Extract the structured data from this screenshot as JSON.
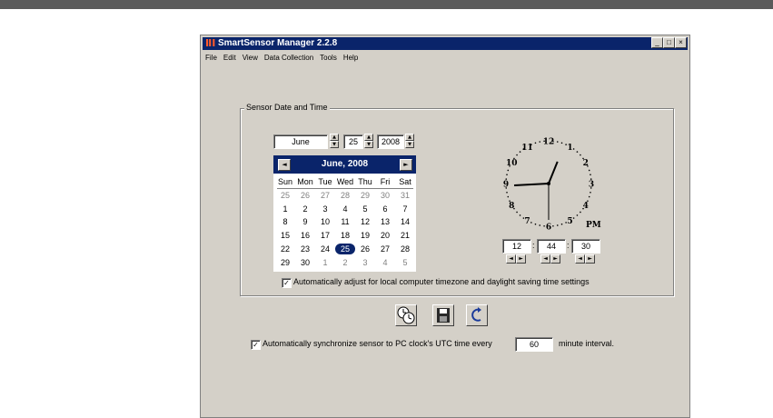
{
  "window": {
    "title": "SmartSensor Manager 2.2.8",
    "controls": {
      "minimize": "_",
      "maximize": "□",
      "close": "×"
    }
  },
  "menu": [
    "File",
    "Edit",
    "View",
    "Data Collection",
    "Tools",
    "Help"
  ],
  "group": {
    "label": "Sensor Date and Time"
  },
  "date": {
    "month": "June",
    "day": "25",
    "year": "2008"
  },
  "calendar": {
    "title": "June, 2008",
    "prev_icon": "◄",
    "next_icon": "►",
    "weekdays": [
      "Sun",
      "Mon",
      "Tue",
      "Wed",
      "Thu",
      "Fri",
      "Sat"
    ],
    "weeks": [
      [
        "25",
        "26",
        "27",
        "28",
        "29",
        "30",
        "31"
      ],
      [
        "1",
        "2",
        "3",
        "4",
        "5",
        "6",
        "7"
      ],
      [
        "8",
        "9",
        "10",
        "11",
        "12",
        "13",
        "14"
      ],
      [
        "15",
        "16",
        "17",
        "18",
        "19",
        "20",
        "21"
      ],
      [
        "22",
        "23",
        "24",
        "25",
        "26",
        "27",
        "28"
      ],
      [
        "29",
        "30",
        "1",
        "2",
        "3",
        "4",
        "5"
      ]
    ],
    "selected": "25"
  },
  "clock": {
    "numerals": [
      "12",
      "1",
      "2",
      "3",
      "4",
      "5",
      "6",
      "7",
      "8",
      "9",
      "10",
      "11"
    ],
    "ampm": "PM",
    "hour": "12",
    "minute": "44",
    "second": "30",
    "sep": ":"
  },
  "auto_adjust": {
    "checked": true,
    "label": "Automatically adjust for local computer timezone and daylight saving time settings"
  },
  "toolbar": {
    "icons": [
      "sync-clock-icon",
      "save-icon",
      "refresh-icon"
    ]
  },
  "auto_sync": {
    "checked": true,
    "label_before": "Automatically synchronize sensor to PC clock's UTC time every",
    "interval": "60",
    "label_after": "minute interval."
  }
}
